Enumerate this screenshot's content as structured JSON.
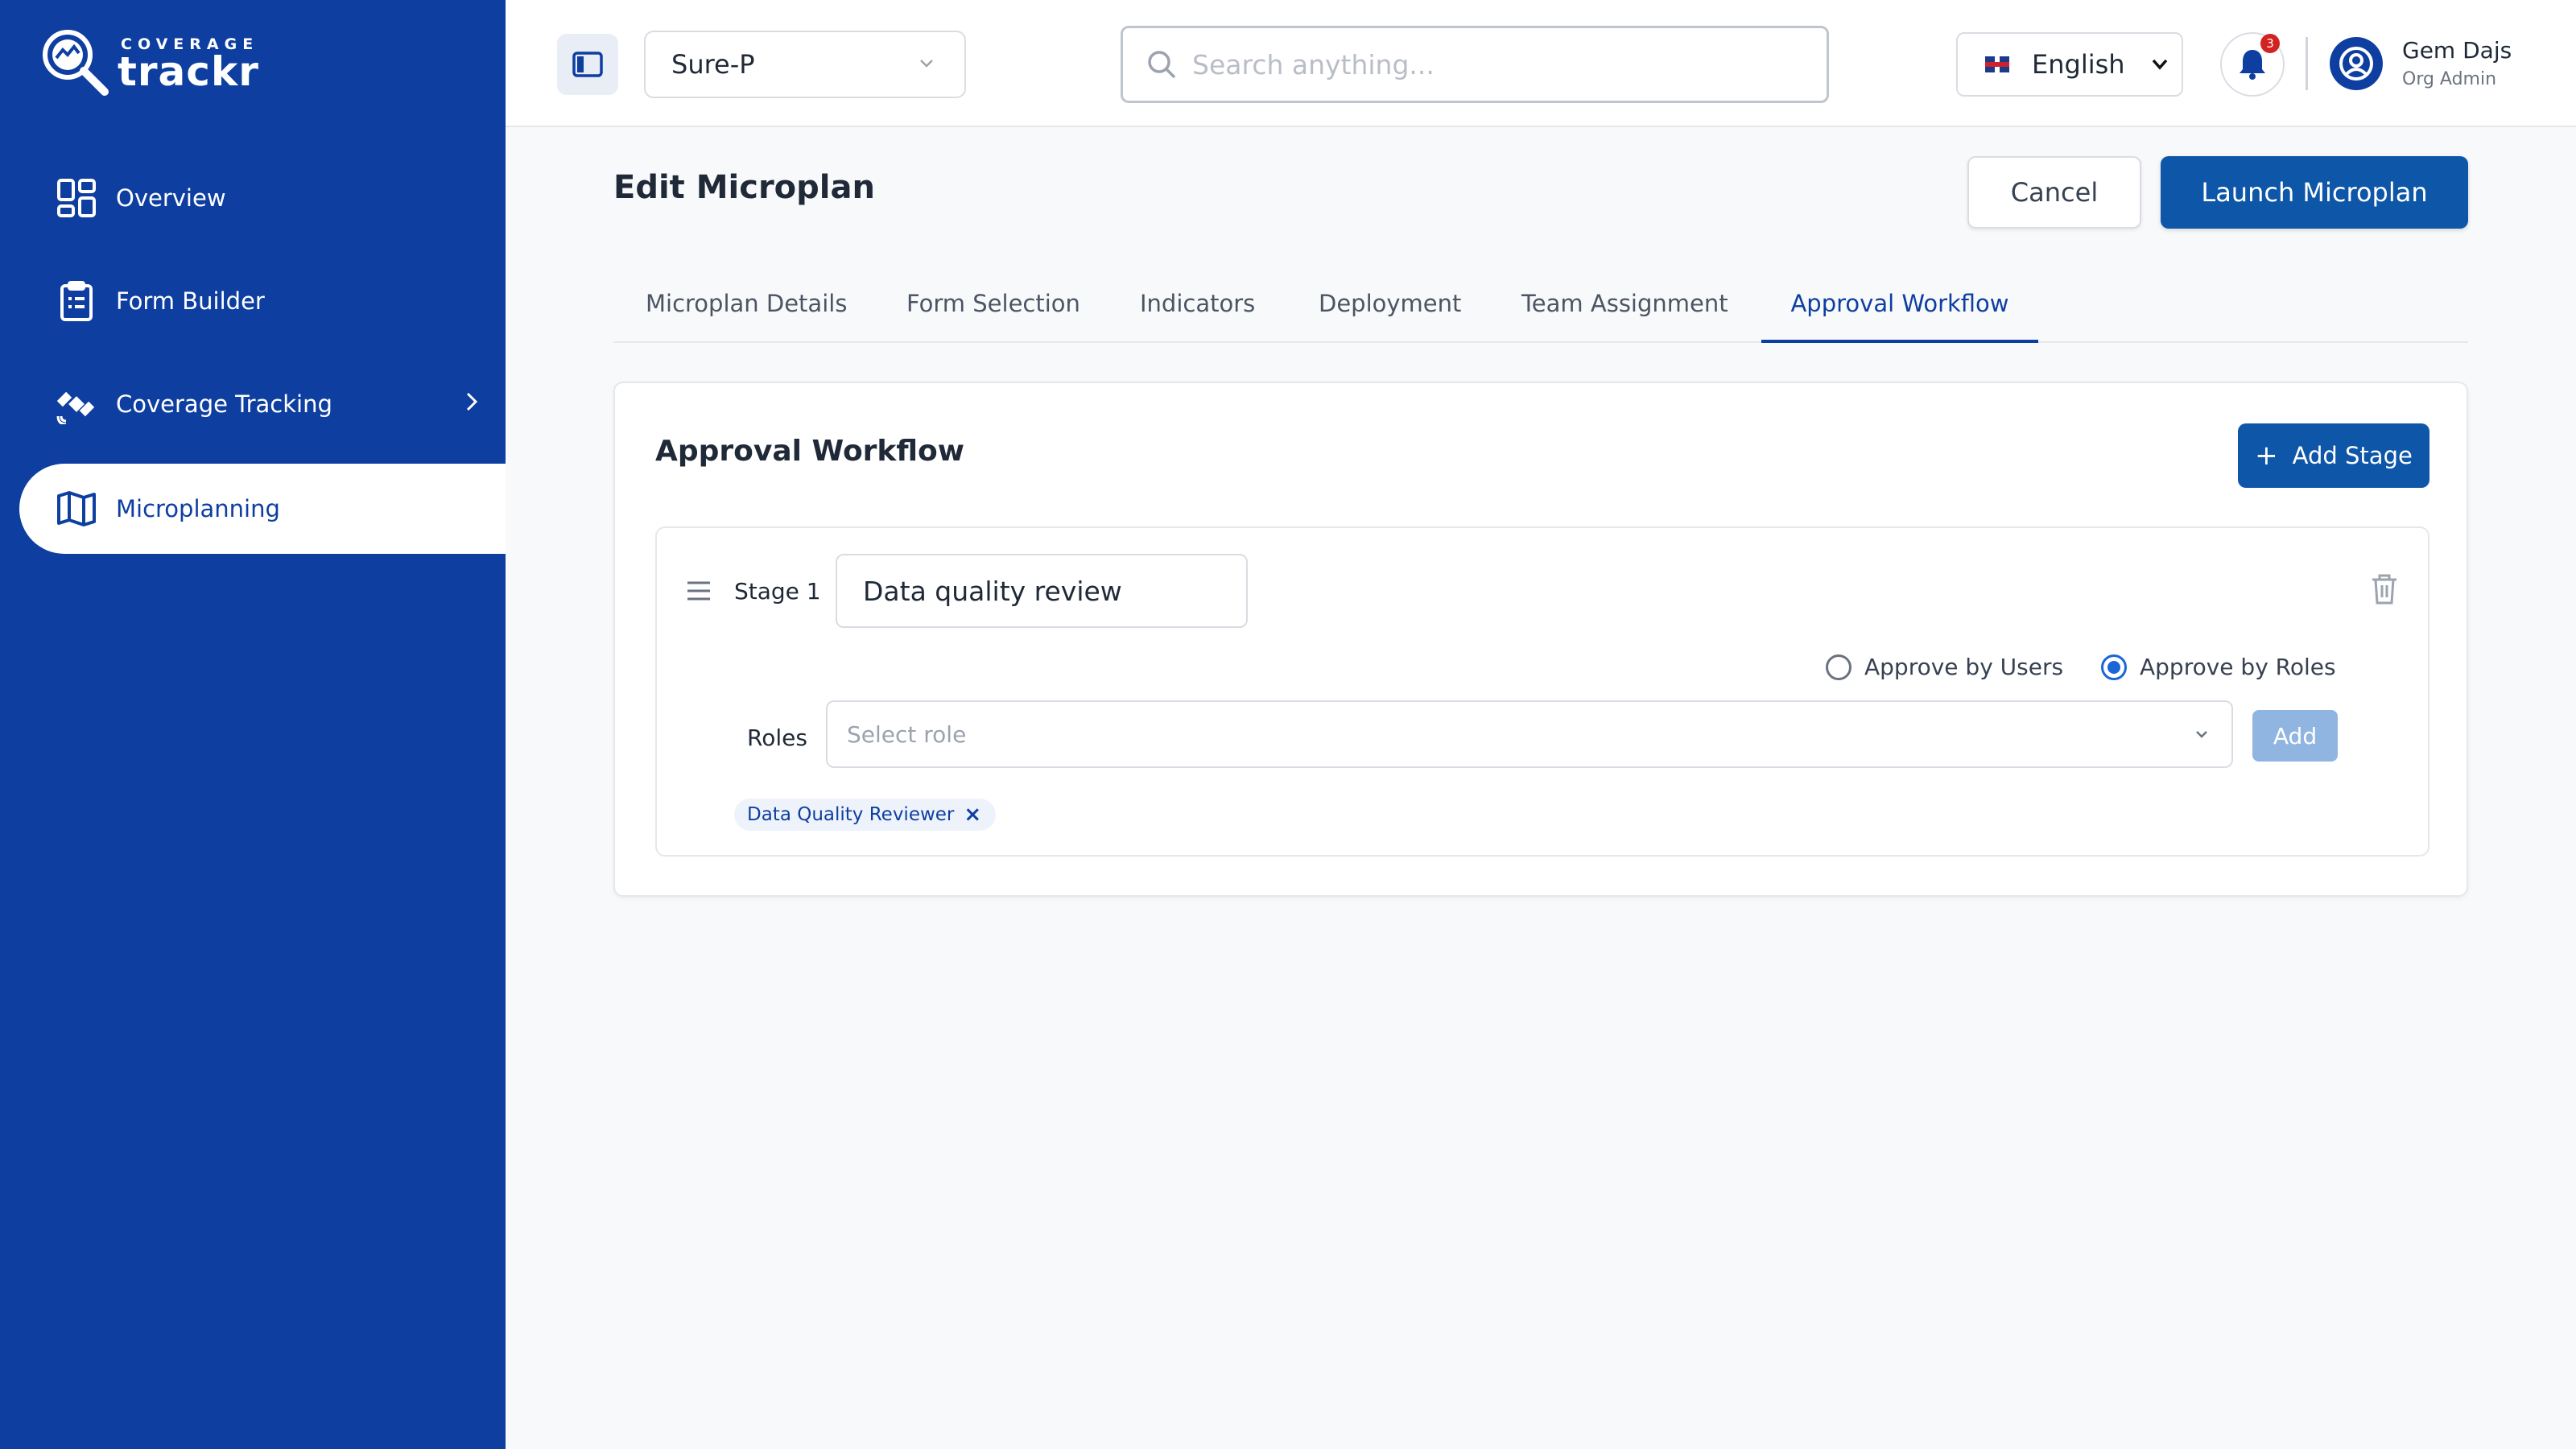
{
  "brand": {
    "top": "COVERAGE",
    "name": "trackr"
  },
  "sidebar": {
    "items": [
      {
        "label": "Overview",
        "icon": "grid-icon"
      },
      {
        "label": "Form Builder",
        "icon": "clipboard-icon"
      },
      {
        "label": "Coverage Tracking",
        "icon": "satellite-icon"
      },
      {
        "label": "Microplanning",
        "icon": "map-icon",
        "active": true
      }
    ]
  },
  "header": {
    "project": "Sure-P",
    "search_placeholder": "Search anything...",
    "language": "English",
    "notifications_count": "3",
    "user": {
      "name": "Gem Dajs",
      "role": "Org Admin"
    }
  },
  "page": {
    "title": "Edit Microplan",
    "cancel_label": "Cancel",
    "launch_label": "Launch Microplan",
    "tabs": [
      {
        "label": "Microplan Details"
      },
      {
        "label": "Form Selection"
      },
      {
        "label": "Indicators"
      },
      {
        "label": "Deployment"
      },
      {
        "label": "Team Assignment"
      },
      {
        "label": "Approval Workflow",
        "active": true
      }
    ]
  },
  "workflow": {
    "title": "Approval Workflow",
    "add_stage_label": "Add Stage",
    "stages": [
      {
        "label": "Stage 1",
        "name": "Data quality review",
        "approve_by_users_label": "Approve by Users",
        "approve_by_roles_label": "Approve by Roles",
        "approve_mode": "roles",
        "roles_label": "Roles",
        "role_placeholder": "Select role",
        "add_label": "Add",
        "selected_roles": [
          "Data Quality Reviewer"
        ]
      }
    ]
  },
  "colors": {
    "sidebar": "#0e3fa0",
    "primary_button": "#0e56a8",
    "active_tab": "#0e3fa0"
  }
}
